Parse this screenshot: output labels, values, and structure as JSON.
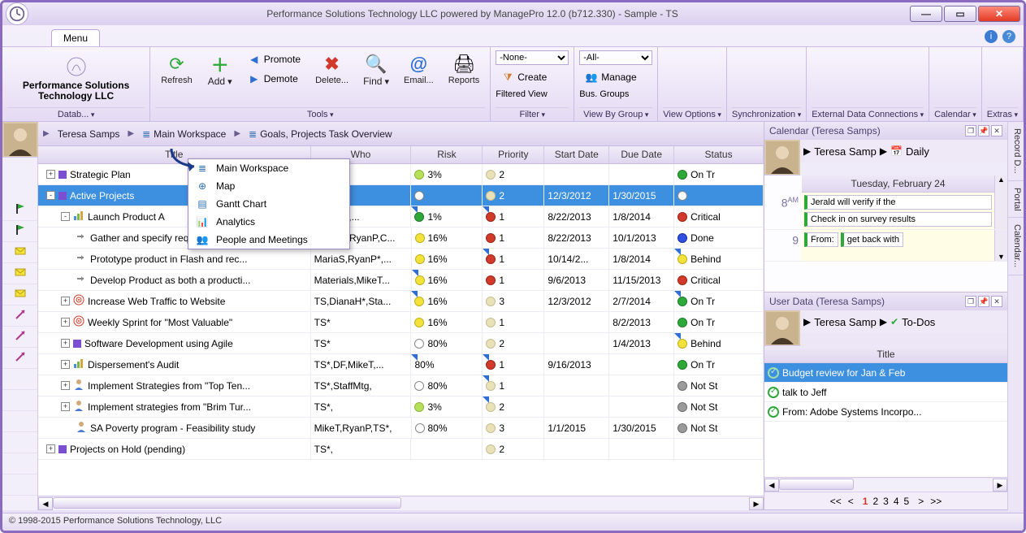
{
  "window": {
    "title": "Performance Solutions Technology LLC powered by ManagePro 12.0 (b712.330) - Sample - TS"
  },
  "menu": {
    "tab": "Menu"
  },
  "ribbon": {
    "brand": "Performance Solutions Technology LLC",
    "group_database": "Datab...",
    "refresh": "Refresh",
    "add": "Add",
    "promote": "Promote",
    "demote": "Demote",
    "delete": "Delete...",
    "find": "Find",
    "email": "Email...",
    "reports": "Reports",
    "group_tools": "Tools",
    "filter_none": "-None-",
    "filter_create": "Create",
    "filter_label": "Filtered View",
    "group_filter": "Filter",
    "groups_all": "-All-",
    "groups_manage": "Manage",
    "groups_label": "Bus. Groups",
    "group_viewby": "View By Group",
    "viewoptions": "View Options",
    "sync": "Synchronization",
    "extdata": "External Data Connections",
    "calendar": "Calendar",
    "extras": "Extras"
  },
  "breadcrumb": {
    "user": "Teresa Samps",
    "workspace": "Main Workspace",
    "page": "Goals, Projects   Task Overview"
  },
  "dropdown": {
    "items": [
      "Main Workspace",
      "Map",
      "Gantt Chart",
      "Analytics",
      "People and Meetings"
    ]
  },
  "columns": {
    "title": "Title",
    "who": "Who",
    "risk": "Risk",
    "priority": "Priority",
    "start": "Start Date",
    "due": "Due Date",
    "status": "Status"
  },
  "rows": [
    {
      "title": "Strategic Plan",
      "who": "",
      "risk": "3%",
      "riskc": "d-ygreen",
      "prio": "2",
      "prioc": "d-tan",
      "start": "",
      "due": "",
      "status": "On Tr",
      "statc": "d-green",
      "indent": 0,
      "toggle": "+",
      "sq": "sq-purple",
      "gut": "flag"
    },
    {
      "title": "Active Projects",
      "who": "",
      "risk": "",
      "riskc": "d-white",
      "prio": "2",
      "prioc": "d-tan",
      "start": "12/3/2012",
      "due": "1/30/2015",
      "status": "",
      "statc": "d-white",
      "indent": 0,
      "toggle": "-",
      "sq": "sq-purple",
      "sel": true,
      "gut": "flag"
    },
    {
      "title": "Launch Product A",
      "who": "MariaS*,...",
      "risk": "1%",
      "riskc": "d-green",
      "prio": "1",
      "prioc": "d-red",
      "start": "8/22/2013",
      "due": "1/8/2014",
      "status": "Critical",
      "statc": "d-red",
      "indent": 1,
      "toggle": "-",
      "icon": "chart",
      "gut": "mail",
      "corners": [
        "risk",
        "prio"
      ]
    },
    {
      "title": "Gather and specify requirements",
      "who": "DianaH,RyanP,C...",
      "risk": "16%",
      "riskc": "d-yellow",
      "prio": "1",
      "prioc": "d-red",
      "start": "8/22/2013",
      "due": "10/1/2013",
      "status": "Done",
      "statc": "d-blue",
      "indent": 2,
      "toggle": "",
      "icon": "arrow",
      "gut": "mail"
    },
    {
      "title": "Prototype product in Flash and rec...",
      "who": "MariaS,RyanP*,...",
      "risk": "16%",
      "riskc": "d-yellow",
      "prio": "1",
      "prioc": "d-red",
      "start": "10/14/2...",
      "due": "1/8/2014",
      "status": "Behind",
      "statc": "d-yellow",
      "indent": 2,
      "toggle": "",
      "icon": "arrow",
      "gut": "mail",
      "corners": [
        "prio",
        "status"
      ]
    },
    {
      "title": "Develop Product as both a producti...",
      "who": "Materials,MikeT...",
      "risk": "16%",
      "riskc": "d-yellow",
      "prio": "1",
      "prioc": "d-red",
      "start": "9/6/2013",
      "due": "11/15/2013",
      "status": "Critical",
      "statc": "d-red",
      "indent": 2,
      "toggle": "",
      "icon": "arrow",
      "gut": "out",
      "corners": [
        "risk"
      ]
    },
    {
      "title": "Increase Web Traffic to Website",
      "who": "TS,DianaH*,Sta...",
      "risk": "16%",
      "riskc": "d-yellow",
      "prio": "3",
      "prioc": "d-tan",
      "start": "12/3/2012",
      "due": "2/7/2014",
      "status": "On Tr",
      "statc": "d-green",
      "indent": 1,
      "toggle": "+",
      "icon": "target",
      "gut": "out",
      "corners": [
        "risk",
        "status"
      ]
    },
    {
      "title": "Weekly Sprint for \"Most Valuable\"",
      "who": "TS*",
      "risk": "16%",
      "riskc": "d-yellow",
      "prio": "1",
      "prioc": "d-tan",
      "start": "",
      "due": "8/2/2013",
      "status": "On Tr",
      "statc": "d-green",
      "indent": 1,
      "toggle": "+",
      "icon": "target",
      "gut": "out"
    },
    {
      "title": "Software Development using Agile",
      "who": "TS*",
      "risk": "80%",
      "riskc": "d-white",
      "prio": "2",
      "prioc": "d-tan",
      "start": "",
      "due": "1/4/2013",
      "status": "Behind",
      "statc": "d-yellow",
      "indent": 1,
      "toggle": "+",
      "sq": "sq-purple",
      "gut": "",
      "corners": [
        "status"
      ]
    },
    {
      "title": "Dispersement's Audit",
      "who": "TS*,DF,MikeT,...",
      "risk": "80%",
      "riskc": "",
      "prio": "1",
      "prioc": "d-red",
      "start": "9/16/2013",
      "due": "",
      "status": "On Tr",
      "statc": "d-green",
      "indent": 1,
      "toggle": "+",
      "icon": "chart",
      "gut": "",
      "corners": [
        "risk",
        "prio"
      ]
    },
    {
      "title": "Implement Strategies from \"Top Ten...",
      "who": "TS*,StaffMtg,",
      "risk": "80%",
      "riskc": "d-white",
      "prio": "1",
      "prioc": "d-tan",
      "start": "",
      "due": "",
      "status": "Not St",
      "statc": "d-gray",
      "indent": 1,
      "toggle": "+",
      "icon": "person",
      "gut": "",
      "corners": [
        "prio"
      ]
    },
    {
      "title": "Implement strategies from \"Brim Tur...",
      "who": "TS*,",
      "risk": "3%",
      "riskc": "d-ygreen",
      "prio": "2",
      "prioc": "d-tan",
      "start": "",
      "due": "",
      "status": "Not St",
      "statc": "d-gray",
      "indent": 1,
      "toggle": "+",
      "icon": "person",
      "gut": "",
      "corners": [
        "prio"
      ]
    },
    {
      "title": "SA Poverty program - Feasibility study",
      "who": "MikeT,RyanP,TS*,",
      "risk": "80%",
      "riskc": "d-white",
      "prio": "3",
      "prioc": "d-tan",
      "start": "1/1/2015",
      "due": "1/30/2015",
      "status": "Not St",
      "statc": "d-gray",
      "indent": 2,
      "toggle": "",
      "icon": "person",
      "gut": ""
    },
    {
      "title": "Projects on Hold (pending)",
      "who": "TS*,",
      "risk": "",
      "riskc": "",
      "prio": "2",
      "prioc": "d-tan",
      "start": "",
      "due": "",
      "status": "",
      "statc": "",
      "indent": 0,
      "toggle": "+",
      "sq": "sq-purple",
      "gut": ""
    }
  ],
  "calendar_pane": {
    "title": "Calendar (Teresa Samps)",
    "nav_user": "Teresa Samp",
    "nav_view": "Daily",
    "day_header": "Tuesday, February 24",
    "slots": [
      {
        "time": "8",
        "ampm": "AM",
        "items": [
          "Jerald will verify if the",
          "Check in on survey results"
        ]
      },
      {
        "time": "9",
        "ampm": "",
        "items": [
          "From:",
          "get back with"
        ]
      }
    ]
  },
  "userdata_pane": {
    "title": "User Data (Teresa Samps)",
    "nav_user": "Teresa Samp",
    "nav_list": "To-Dos",
    "col": "Title",
    "rows": [
      {
        "t": "Budget review for Jan & Feb",
        "sel": true
      },
      {
        "t": "talk to Jeff"
      },
      {
        "t": "From: Adobe Systems Incorpo..."
      }
    ],
    "pager": {
      "pages": [
        "1",
        "2",
        "3",
        "4",
        "5"
      ],
      "current": "1"
    }
  },
  "sidetabs": [
    "Record D...",
    "Portal",
    "Calendar..."
  ],
  "statusbar": "© 1998-2015 Performance Solutions Technology, LLC"
}
